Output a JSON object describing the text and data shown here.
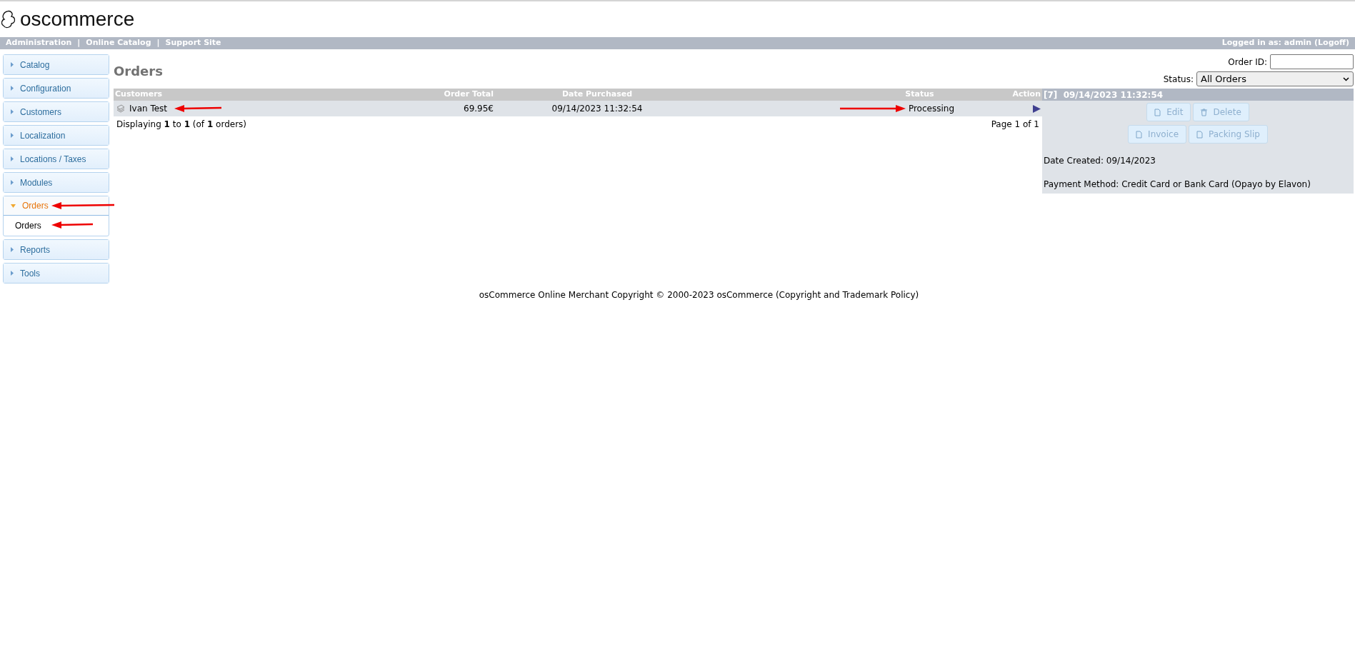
{
  "logo": {
    "text": "oscommerce"
  },
  "top_nav": {
    "links": [
      "Administration",
      "Online Catalog",
      "Support Site"
    ],
    "separator": "|",
    "login": "Logged in as: admin (Logoff)"
  },
  "sidebar": {
    "items": [
      {
        "label": "Catalog",
        "expanded": false
      },
      {
        "label": "Configuration",
        "expanded": false
      },
      {
        "label": "Customers",
        "expanded": false
      },
      {
        "label": "Localization",
        "expanded": false
      },
      {
        "label": "Locations / Taxes",
        "expanded": false
      },
      {
        "label": "Modules",
        "expanded": false
      },
      {
        "label": "Orders",
        "expanded": true,
        "children": [
          {
            "label": "Orders"
          }
        ]
      },
      {
        "label": "Reports",
        "expanded": false
      },
      {
        "label": "Tools",
        "expanded": false
      }
    ]
  },
  "page_title": "Orders",
  "filters": {
    "order_id_label": "Order ID:",
    "status_label": "Status:",
    "status_value": "All Orders"
  },
  "table": {
    "columns": [
      "Customers",
      "Order Total",
      "Date Purchased",
      "Status",
      "Action"
    ],
    "rows": [
      {
        "customer": "Ivan Test",
        "total": "69.95€",
        "date": "09/14/2023 11:32:54",
        "status": "Processing",
        "selected": true
      }
    ],
    "summary": "Displaying **1** to **1** (of **1** orders)",
    "pagination": "Page 1 of 1"
  },
  "detail": {
    "title": "[7]  09/14/2023 11:32:54",
    "button_rows": [
      [
        {
          "label": "Edit",
          "kind": "doc"
        },
        {
          "label": "Delete",
          "kind": "trash"
        }
      ],
      [
        {
          "label": "Invoice",
          "kind": "doc"
        },
        {
          "label": "Packing Slip",
          "kind": "doc"
        }
      ]
    ],
    "lines": [
      "Date Created: 09/14/2023",
      "Payment Method: Credit Card or Bank Card (Opayo by Elavon)"
    ]
  },
  "footer": "osCommerce Online Merchant Copyright © 2000-2023 osCommerce (Copyright and Trademark Policy)"
}
